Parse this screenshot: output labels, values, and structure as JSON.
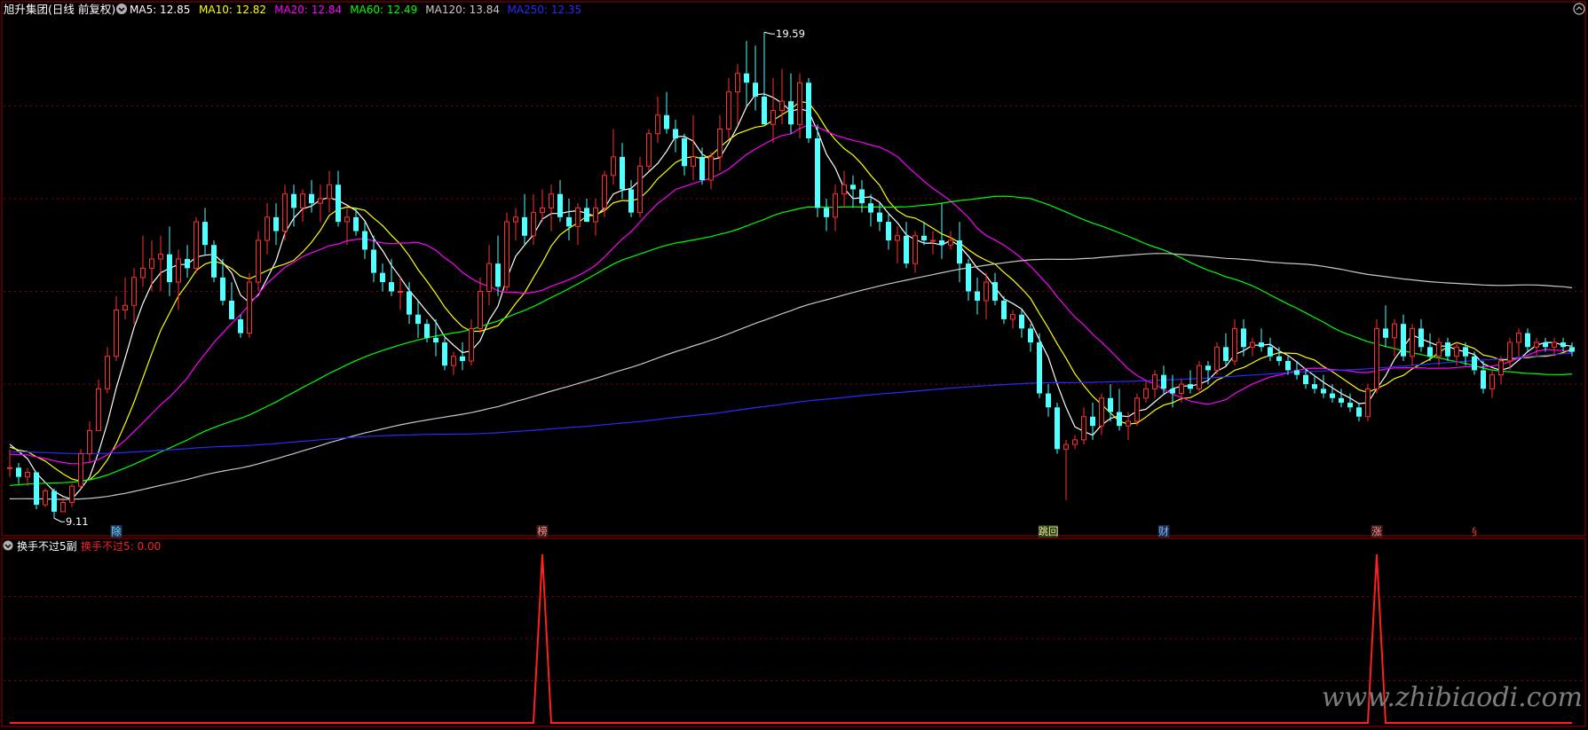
{
  "header": {
    "title": "旭升集团(日线 前复权)",
    "ma": [
      {
        "label": "MA5: 12.85",
        "color": "#ffffff"
      },
      {
        "label": "MA10: 12.82",
        "color": "#ffff00"
      },
      {
        "label": "MA20: 12.84",
        "color": "#ff00ff"
      },
      {
        "label": "MA60: 12.49",
        "color": "#00ff00"
      },
      {
        "label": "MA120: 13.84",
        "color": "#c8c8c8"
      },
      {
        "label": "MA250: 12.35",
        "color": "#2a2aff"
      }
    ]
  },
  "sub_header": {
    "title": "换手不过5副",
    "value_label": "换手不过5: 0.00",
    "value_color": "#ff2020"
  },
  "markers": [
    {
      "text": "除",
      "bar": 12,
      "bg": "#1c3a5a",
      "color": "#7fd4ff"
    },
    {
      "text": "榜",
      "bar": 60,
      "bg": "#3a1c1c",
      "color": "#ff8a8a"
    },
    {
      "text": "跳回",
      "bar": 117,
      "bg": "#1e3f1e",
      "color": "#ffe08a"
    },
    {
      "text": "财",
      "bar": 130,
      "bg": "#1c2a4a",
      "color": "#8ab4ff"
    },
    {
      "text": "涨",
      "bar": 154,
      "bg": "#3a1c1c",
      "color": "#ff8a8a"
    },
    {
      "text": "§",
      "bar": 165,
      "bg": "transparent",
      "color": "#ff3030"
    }
  ],
  "watermark": "www.zhibiaodi.com",
  "colors": {
    "up": "#ff3030",
    "down": "#54ffff",
    "grid": "#8b0000",
    "axis": "#a00000"
  },
  "chart_data": [
    {
      "type": "candlestick",
      "title": "旭升集团(日线 前复权)",
      "annotations": [
        {
          "text": "19.59",
          "type": "high",
          "bar": 85,
          "value": 19.59
        },
        {
          "text": "9.11",
          "type": "low",
          "bar": 5,
          "value": 9.11
        }
      ],
      "ylim": [
        9.0,
        19.9
      ],
      "grid": true,
      "ohlc": [
        [
          10.2,
          10.6,
          10.0,
          10.2
        ],
        [
          10.2,
          10.3,
          9.85,
          10.0
        ],
        [
          10.0,
          10.2,
          9.8,
          10.1
        ],
        [
          10.1,
          10.1,
          9.3,
          9.4
        ],
        [
          9.4,
          9.75,
          9.35,
          9.7
        ],
        [
          9.7,
          9.75,
          9.11,
          9.25
        ],
        [
          9.25,
          9.55,
          9.25,
          9.45
        ],
        [
          9.45,
          9.85,
          9.35,
          9.8
        ],
        [
          9.8,
          10.6,
          9.75,
          10.5
        ],
        [
          10.5,
          11.2,
          10.3,
          11.0
        ],
        [
          11.0,
          12.1,
          11.0,
          11.9
        ],
        [
          11.9,
          12.8,
          11.8,
          12.6
        ],
        [
          12.6,
          13.9,
          12.5,
          13.6
        ],
        [
          13.6,
          14.3,
          13.4,
          13.7
        ],
        [
          13.7,
          14.5,
          13.3,
          14.3
        ],
        [
          14.3,
          15.2,
          14.1,
          14.5
        ],
        [
          14.5,
          15.1,
          14.0,
          14.7
        ],
        [
          14.7,
          15.2,
          14.0,
          14.8
        ],
        [
          14.8,
          15.4,
          13.9,
          14.2
        ],
        [
          14.2,
          14.9,
          13.6,
          14.7
        ],
        [
          14.7,
          15.0,
          14.3,
          14.5
        ],
        [
          14.5,
          15.6,
          14.4,
          15.5
        ],
        [
          15.5,
          15.8,
          14.8,
          15.0
        ],
        [
          15.0,
          15.1,
          14.2,
          14.3
        ],
        [
          14.3,
          14.7,
          13.7,
          13.8
        ],
        [
          13.8,
          14.2,
          13.4,
          13.4
        ],
        [
          13.4,
          13.5,
          13.0,
          13.1
        ],
        [
          13.1,
          14.4,
          13.0,
          14.2
        ],
        [
          14.2,
          15.3,
          14.0,
          15.1
        ],
        [
          15.1,
          15.9,
          14.8,
          15.6
        ],
        [
          15.6,
          15.9,
          15.0,
          15.3
        ],
        [
          15.3,
          16.3,
          15.1,
          16.1
        ],
        [
          16.1,
          16.3,
          15.4,
          15.8
        ],
        [
          15.8,
          16.2,
          15.5,
          16.1
        ],
        [
          16.1,
          16.4,
          15.7,
          15.9
        ],
        [
          15.9,
          16.3,
          15.5,
          16.0
        ],
        [
          16.0,
          16.6,
          15.7,
          16.3
        ],
        [
          16.3,
          16.6,
          15.4,
          15.5
        ],
        [
          15.5,
          15.8,
          15.0,
          15.6
        ],
        [
          15.6,
          15.8,
          15.2,
          15.3
        ],
        [
          15.3,
          15.5,
          14.7,
          14.9
        ],
        [
          14.9,
          15.2,
          14.2,
          14.4
        ],
        [
          14.4,
          14.6,
          14.0,
          14.2
        ],
        [
          14.2,
          14.7,
          13.9,
          14.0
        ],
        [
          14.0,
          14.3,
          13.6,
          14.0
        ],
        [
          14.0,
          14.2,
          13.3,
          13.5
        ],
        [
          13.5,
          13.8,
          13.0,
          13.3
        ],
        [
          13.3,
          13.4,
          12.9,
          13.0
        ],
        [
          13.0,
          13.4,
          12.6,
          12.9
        ],
        [
          12.9,
          13.0,
          12.3,
          12.4
        ],
        [
          12.4,
          12.7,
          12.2,
          12.6
        ],
        [
          12.6,
          12.9,
          12.3,
          12.5
        ],
        [
          12.5,
          13.4,
          12.4,
          13.2
        ],
        [
          13.2,
          14.3,
          13.1,
          14.0
        ],
        [
          14.0,
          15.0,
          13.7,
          14.6
        ],
        [
          14.6,
          15.2,
          13.9,
          14.1
        ],
        [
          14.1,
          15.7,
          14.0,
          15.5
        ],
        [
          15.5,
          15.8,
          15.1,
          15.6
        ],
        [
          15.6,
          16.1,
          15.0,
          15.2
        ],
        [
          15.2,
          16.1,
          15.0,
          15.7
        ],
        [
          15.7,
          16.2,
          15.5,
          15.8
        ],
        [
          15.8,
          16.3,
          15.3,
          16.1
        ],
        [
          16.1,
          16.4,
          15.5,
          15.6
        ],
        [
          15.6,
          16.0,
          15.1,
          15.4
        ],
        [
          15.4,
          15.9,
          15.0,
          15.8
        ],
        [
          15.8,
          16.0,
          15.5,
          15.5
        ],
        [
          15.5,
          16.0,
          15.2,
          15.8
        ],
        [
          15.8,
          16.6,
          15.6,
          16.5
        ],
        [
          16.5,
          17.5,
          16.3,
          16.9
        ],
        [
          16.9,
          17.2,
          16.0,
          16.2
        ],
        [
          16.2,
          16.4,
          15.6,
          15.7
        ],
        [
          15.7,
          16.9,
          15.6,
          16.7
        ],
        [
          16.7,
          17.5,
          16.6,
          17.4
        ],
        [
          17.4,
          18.2,
          17.2,
          17.8
        ],
        [
          17.8,
          18.3,
          17.4,
          17.5
        ],
        [
          17.5,
          17.7,
          17.0,
          17.3
        ],
        [
          17.3,
          17.4,
          16.5,
          16.7
        ],
        [
          16.7,
          17.8,
          16.4,
          16.9
        ],
        [
          16.9,
          17.1,
          16.3,
          16.4
        ],
        [
          16.4,
          17.0,
          16.2,
          16.9
        ],
        [
          16.9,
          17.8,
          16.6,
          17.5
        ],
        [
          17.5,
          18.6,
          17.3,
          18.3
        ],
        [
          18.3,
          18.9,
          17.6,
          18.7
        ],
        [
          18.7,
          19.4,
          18.0,
          18.5
        ],
        [
          18.5,
          19.3,
          17.9,
          18.2
        ],
        [
          18.2,
          19.59,
          17.9,
          17.6
        ],
        [
          17.6,
          18.6,
          17.2,
          17.9
        ],
        [
          17.9,
          18.8,
          17.6,
          18.1
        ],
        [
          18.1,
          18.7,
          17.4,
          17.6
        ],
        [
          17.6,
          18.7,
          17.3,
          18.5
        ],
        [
          18.5,
          18.6,
          17.2,
          17.3
        ],
        [
          17.3,
          17.6,
          15.6,
          15.8
        ],
        [
          15.8,
          16.0,
          15.3,
          15.6
        ],
        [
          15.6,
          16.3,
          15.3,
          16.1
        ],
        [
          16.1,
          16.6,
          15.8,
          16.3
        ],
        [
          16.3,
          16.5,
          15.8,
          16.2
        ],
        [
          16.2,
          16.4,
          15.7,
          15.9
        ],
        [
          15.9,
          16.1,
          15.4,
          15.7
        ],
        [
          15.7,
          15.9,
          15.3,
          15.5
        ],
        [
          15.5,
          15.7,
          14.9,
          15.1
        ],
        [
          15.1,
          15.4,
          14.6,
          15.2
        ],
        [
          15.2,
          15.5,
          14.5,
          14.6
        ],
        [
          14.6,
          15.3,
          14.4,
          15.2
        ],
        [
          15.2,
          15.5,
          15.0,
          15.1
        ],
        [
          15.1,
          15.3,
          14.8,
          15.1
        ],
        [
          15.1,
          15.9,
          14.7,
          15.0
        ],
        [
          15.0,
          15.3,
          14.9,
          15.1
        ],
        [
          15.1,
          15.5,
          14.2,
          14.6
        ],
        [
          14.6,
          14.7,
          13.8,
          14.0
        ],
        [
          14.0,
          14.3,
          13.5,
          13.8
        ],
        [
          13.8,
          14.4,
          13.4,
          14.2
        ],
        [
          14.2,
          14.4,
          13.7,
          13.8
        ],
        [
          13.8,
          13.9,
          13.3,
          13.4
        ],
        [
          13.4,
          13.6,
          13.2,
          13.5
        ],
        [
          13.5,
          13.6,
          13.0,
          13.2
        ],
        [
          13.2,
          13.3,
          12.7,
          12.9
        ],
        [
          12.9,
          13.1,
          11.7,
          11.8
        ],
        [
          11.8,
          12.0,
          11.3,
          11.5
        ],
        [
          11.5,
          11.6,
          10.5,
          10.6
        ],
        [
          10.6,
          10.8,
          9.5,
          10.7
        ],
        [
          10.7,
          10.9,
          10.6,
          10.8
        ],
        [
          10.8,
          11.5,
          10.7,
          11.3
        ],
        [
          11.3,
          11.6,
          10.8,
          11.1
        ],
        [
          11.1,
          11.8,
          10.9,
          11.7
        ],
        [
          11.7,
          12.0,
          11.2,
          11.4
        ],
        [
          11.4,
          11.9,
          11.0,
          11.1
        ],
        [
          11.1,
          11.4,
          10.8,
          11.2
        ],
        [
          11.2,
          11.8,
          11.1,
          11.7
        ],
        [
          11.7,
          12.1,
          11.6,
          11.9
        ],
        [
          11.9,
          12.3,
          11.7,
          12.2
        ],
        [
          12.2,
          12.4,
          11.8,
          11.9
        ],
        [
          11.9,
          12.2,
          11.5,
          11.8
        ],
        [
          11.8,
          12.1,
          11.6,
          12.0
        ],
        [
          12.0,
          12.3,
          11.8,
          11.9
        ],
        [
          11.9,
          12.5,
          11.8,
          12.4
        ],
        [
          12.4,
          12.5,
          12.0,
          12.3
        ],
        [
          12.3,
          12.9,
          12.2,
          12.8
        ],
        [
          12.8,
          13.1,
          12.4,
          12.5
        ],
        [
          12.5,
          13.4,
          12.4,
          13.2
        ],
        [
          13.2,
          13.4,
          12.6,
          12.8
        ],
        [
          12.8,
          13.0,
          12.6,
          12.9
        ],
        [
          12.9,
          13.2,
          12.7,
          12.8
        ],
        [
          12.8,
          13.0,
          12.5,
          12.6
        ],
        [
          12.6,
          12.8,
          12.4,
          12.5
        ],
        [
          12.5,
          12.6,
          12.2,
          12.3
        ],
        [
          12.3,
          12.5,
          12.1,
          12.2
        ],
        [
          12.2,
          12.3,
          11.9,
          12.0
        ],
        [
          12.0,
          12.2,
          11.8,
          11.9
        ],
        [
          11.9,
          12.2,
          11.7,
          11.8
        ],
        [
          11.8,
          12.0,
          11.6,
          11.7
        ],
        [
          11.7,
          11.9,
          11.5,
          11.6
        ],
        [
          11.6,
          11.8,
          11.4,
          11.5
        ],
        [
          11.5,
          11.6,
          11.2,
          11.3
        ],
        [
          11.3,
          12.0,
          11.2,
          11.9
        ],
        [
          11.9,
          13.4,
          11.8,
          13.2
        ],
        [
          13.2,
          13.7,
          12.8,
          13.0
        ],
        [
          13.0,
          13.4,
          12.6,
          13.3
        ],
        [
          13.3,
          13.5,
          12.5,
          12.6
        ],
        [
          12.6,
          13.3,
          12.4,
          13.2
        ],
        [
          13.2,
          13.4,
          12.7,
          12.8
        ],
        [
          12.8,
          13.1,
          12.5,
          12.6
        ],
        [
          12.6,
          13.0,
          12.4,
          12.9
        ],
        [
          12.9,
          13.0,
          12.5,
          12.6
        ],
        [
          12.6,
          12.9,
          12.4,
          12.8
        ],
        [
          12.8,
          12.9,
          12.4,
          12.6
        ],
        [
          12.6,
          12.7,
          12.2,
          12.3
        ],
        [
          12.3,
          12.5,
          11.8,
          11.9
        ],
        [
          11.9,
          12.3,
          11.7,
          12.2
        ],
        [
          12.2,
          12.6,
          12.0,
          12.5
        ],
        [
          12.5,
          13.0,
          12.3,
          12.9
        ],
        [
          12.9,
          13.2,
          12.6,
          13.1
        ],
        [
          13.1,
          13.2,
          12.7,
          12.8
        ],
        [
          12.8,
          13.0,
          12.6,
          12.9
        ],
        [
          12.9,
          13.0,
          12.7,
          12.8
        ],
        [
          12.8,
          13.0,
          12.6,
          12.9
        ],
        [
          12.9,
          13.0,
          12.7,
          12.8
        ],
        [
          12.8,
          12.9,
          12.6,
          12.7
        ]
      ],
      "series": [
        {
          "name": "MA5",
          "color": "#ffffff",
          "period": 5
        },
        {
          "name": "MA10",
          "color": "#ffff00",
          "period": 10
        },
        {
          "name": "MA20",
          "color": "#ff00ff",
          "period": 20
        },
        {
          "name": "MA60",
          "color": "#00ff00",
          "period": 60
        },
        {
          "name": "MA120",
          "color": "#c8c8c8",
          "period": 120
        },
        {
          "name": "MA250",
          "color": "#2a2aff",
          "period": 250
        }
      ]
    },
    {
      "type": "line",
      "title": "换手不过5副",
      "series": [
        {
          "name": "换手不过5",
          "color": "#ff2020",
          "spikes": [
            60,
            154
          ]
        }
      ],
      "ylim": [
        0,
        1
      ]
    }
  ]
}
